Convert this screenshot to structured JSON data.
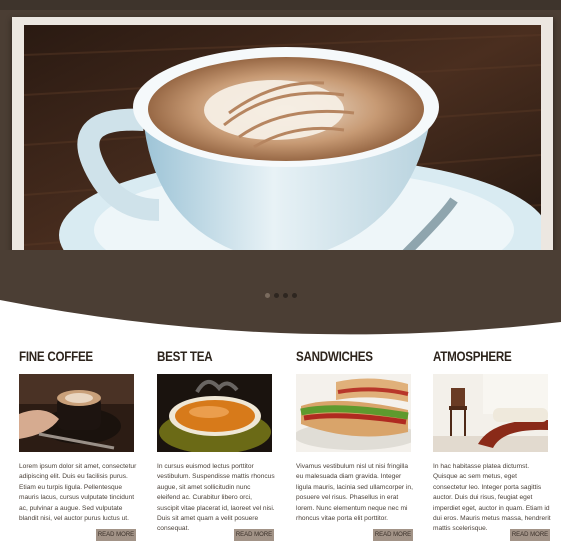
{
  "slider": {
    "dots": 4,
    "active_index": 0
  },
  "columns": [
    {
      "title": "FINE COFFEE",
      "text": "Lorem ipsum dolor sit amet, consectetur adipiscing elit. Duis eu facilisis purus. Etiam eu turpis ligula. Pellentesque mauris lacus, cursus vulputate tincidunt ac, pulvinar a augue. Sed vulputate blandit nisi, vel auctor purus luctus ut.",
      "button": "READ MORE"
    },
    {
      "title": "BEST TEA",
      "text": "In cursus euismod lectus porttitor vestibulum. Suspendisse mattis rhoncus augue, sit amet sollicitudin nunc eleifend ac. Curabitur libero orci, suscipit vitae placerat id, laoreet vel nisi. Duis sit amet quam a velit posuere consequat.",
      "button": "READ MORE"
    },
    {
      "title": "SANDWICHES",
      "text": "Vivamus vestibulum nisl ut nisi fringilla eu malesuada diam gravida. Integer ligula mauris, lacinia sed ullamcorper in, posuere vel risus. Phasellus in erat lorem. Nunc elementum neque nec mi rhoncus vitae porta elit porttitor.",
      "button": "READ MORE"
    },
    {
      "title": "ATMOSPHERE",
      "text": "In hac habitasse platea dictumst. Quisque ac sem metus, eget consectetur leo. Integer porta sagittis auctor. Duis dui risus, feugiat eget imperdiet eget, auctor in quam. Etiam id dui eros. Mauris metus massa, hendrerit mattis scelerisque.",
      "button": "READ MORE"
    }
  ]
}
